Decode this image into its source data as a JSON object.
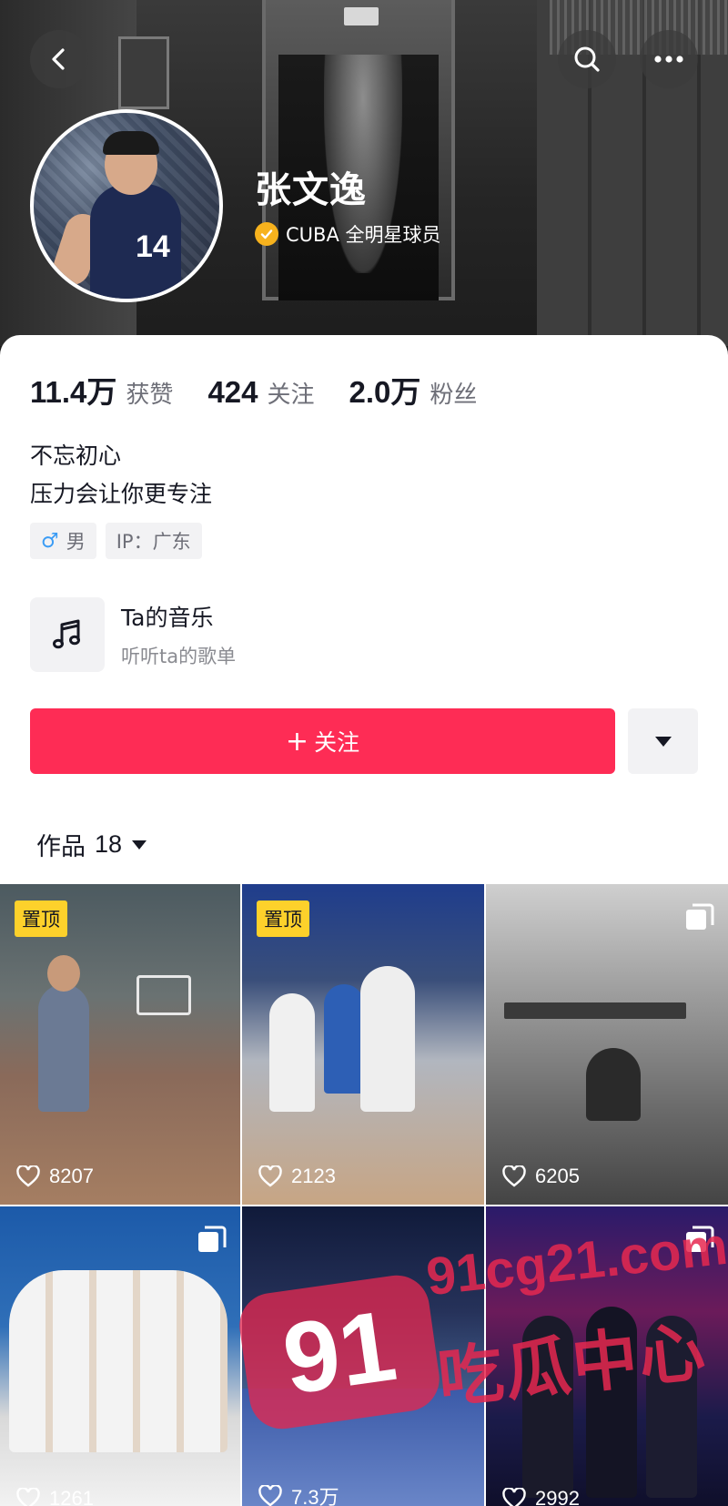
{
  "header": {
    "name": "张文逸",
    "verification": "CUBA 全明星球员",
    "avatar_jersey_number": "14"
  },
  "stats": [
    {
      "value": "11.4万",
      "label": "获赞"
    },
    {
      "value": "424",
      "label": "关注"
    },
    {
      "value": "2.0万",
      "label": "粉丝"
    }
  ],
  "bio": [
    "不忘初心",
    "压力会让你更专注"
  ],
  "tags": {
    "gender_symbol": "♂",
    "gender": "男",
    "ip": "IP：广东"
  },
  "music": {
    "title": "Ta的音乐",
    "subtitle": "听听ta的歌单"
  },
  "follow_button": {
    "plus": "+",
    "label": "关注"
  },
  "works_tab": {
    "label": "作品",
    "count": "18"
  },
  "videos": [
    {
      "pinned": "置顶",
      "likes": "8207",
      "multi": false
    },
    {
      "pinned": "置顶",
      "likes": "2123",
      "multi": false
    },
    {
      "pinned": "",
      "likes": "6205",
      "multi": true
    },
    {
      "pinned": "",
      "likes": "1261",
      "multi": true
    },
    {
      "pinned": "",
      "likes": "7.3万",
      "multi": false
    },
    {
      "pinned": "",
      "likes": "2992",
      "multi": true
    }
  ],
  "watermark": {
    "badge": "91",
    "url": "91cg21.com",
    "text": "吃瓜中心"
  },
  "colors": {
    "accent": "#fe2c55",
    "pin_badge": "#fdd12b",
    "verify_badge": "#f7b21d"
  }
}
